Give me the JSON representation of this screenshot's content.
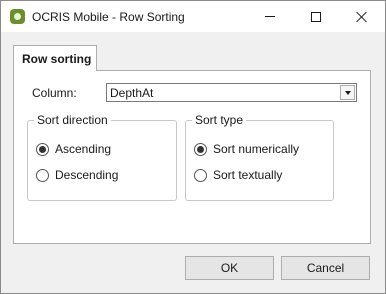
{
  "window": {
    "title": "OCRIS Mobile - Row Sorting",
    "app_icon": "ocris-app-icon",
    "controls": {
      "minimize_icon": "minimize-icon",
      "maximize_icon": "maximize-icon",
      "close_icon": "close-icon"
    }
  },
  "tabs": [
    {
      "label": "Row sorting",
      "selected": true
    }
  ],
  "column": {
    "label": "Column:",
    "value": "DepthAt"
  },
  "sort_direction": {
    "title": "Sort direction",
    "options": [
      {
        "label": "Ascending",
        "checked": true
      },
      {
        "label": "Descending",
        "checked": false
      }
    ]
  },
  "sort_type": {
    "title": "Sort type",
    "options": [
      {
        "label": "Sort numerically",
        "checked": true
      },
      {
        "label": "Sort textually",
        "checked": false
      }
    ]
  },
  "buttons": {
    "ok": "OK",
    "cancel": "Cancel"
  },
  "colors": {
    "app_icon": "#6b8f2e",
    "dialog_bg": "#f0f0f0",
    "panel_bg": "#ffffff"
  }
}
